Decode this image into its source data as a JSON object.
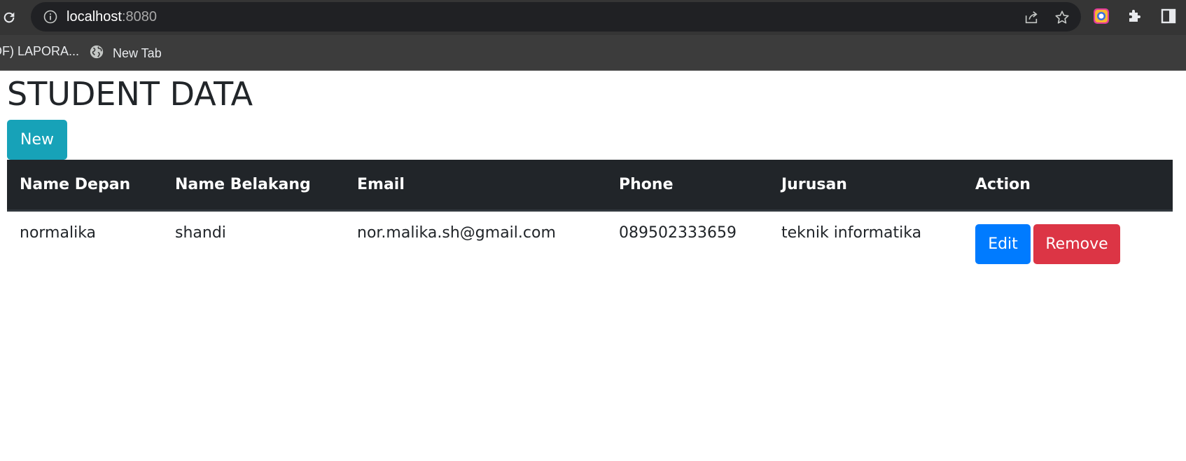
{
  "browser": {
    "url_host": "localhost",
    "url_port": ":8080",
    "bookmarks": [
      {
        "label": "DF) LAPORA..."
      },
      {
        "label": "New Tab"
      }
    ]
  },
  "page": {
    "title": "STUDENT DATA",
    "new_button": "New"
  },
  "table": {
    "headers": [
      "Name Depan",
      "Name Belakang",
      "Email",
      "Phone",
      "Jurusan",
      "Action"
    ],
    "rows": [
      {
        "name_depan": "normalika",
        "name_belakang": "shandi",
        "email": "nor.malika.sh@gmail.com",
        "phone": "089502333659",
        "jurusan": "teknik informatika",
        "edit_label": "Edit",
        "remove_label": "Remove"
      }
    ]
  },
  "colors": {
    "new_button": "#17a2b8",
    "edit_button": "#007bff",
    "remove_button": "#dc3545",
    "table_header": "#212529"
  }
}
